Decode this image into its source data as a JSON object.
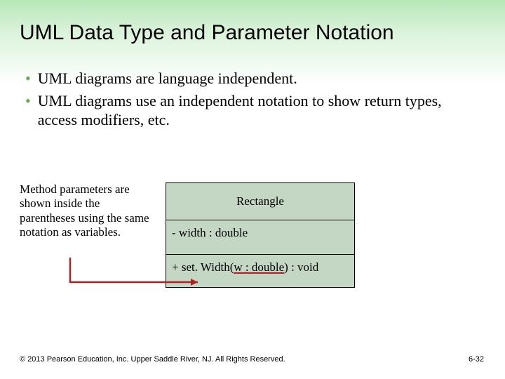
{
  "title": "UML Data Type and Parameter Notation",
  "bullets": [
    "UML diagrams are language independent.",
    "UML diagrams use an independent notation to show return types, access modifiers, etc."
  ],
  "note": "Method parameters are shown inside the parentheses using the same notation as variables.",
  "uml": {
    "class_name": "Rectangle",
    "attribute": "- width : double",
    "method_prefix": "+ set. Width(",
    "method_param": "w : double",
    "method_suffix": ") : void"
  },
  "footer": {
    "copyright": "© 2013 Pearson Education, Inc. Upper Saddle River, NJ. All Rights Reserved.",
    "page": "6-32"
  },
  "colors": {
    "bullet": "#6aa84f",
    "uml_fill": "#c4d6c4",
    "arrow": "#b02020"
  }
}
